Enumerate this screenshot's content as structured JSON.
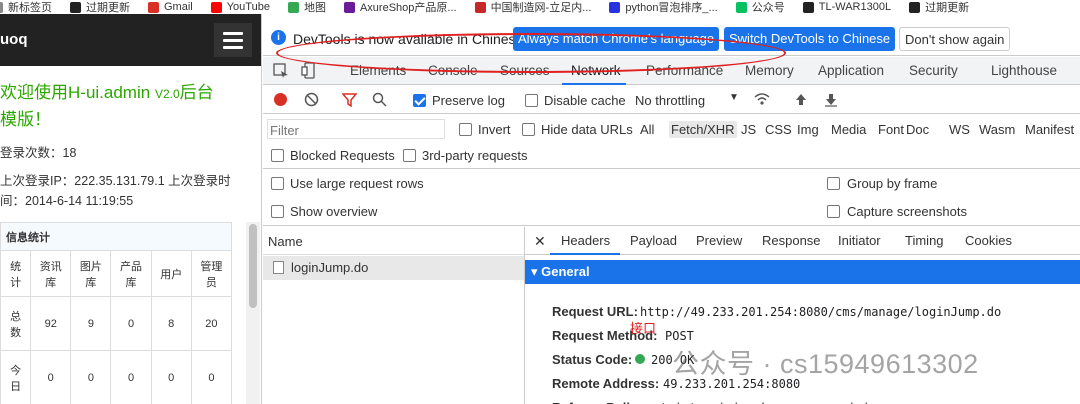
{
  "bookmarks": [
    {
      "label": "新标签页",
      "icon": "tab-icon",
      "color": "#888888"
    },
    {
      "label": "过期更新",
      "icon": "github-icon",
      "color": "#222222"
    },
    {
      "label": "Gmail",
      "icon": "gmail-icon",
      "color": "#d93025"
    },
    {
      "label": "YouTube",
      "icon": "youtube-icon",
      "color": "#ff0000"
    },
    {
      "label": "地图",
      "icon": "maps-icon",
      "color": "#34a853"
    },
    {
      "label": "AxureShop产品原...",
      "icon": "axure-icon",
      "color": "#6a1b9a"
    },
    {
      "label": "中国制造网-立足内...",
      "icon": "mic-icon",
      "color": "#c62828"
    },
    {
      "label": "python冒泡排序_...",
      "icon": "baidu-icon",
      "color": "#2932e1"
    },
    {
      "label": "公众号",
      "icon": "wechat-icon",
      "color": "#07c160"
    },
    {
      "label": "TL-WAR1300L",
      "icon": "tplink-icon",
      "color": "#222222"
    },
    {
      "label": "过期更新",
      "icon": "github-icon",
      "color": "#222222"
    }
  ],
  "admin": {
    "logo": "uoq",
    "welcome_line1": "欢迎使用H-ui.admin",
    "version": "V2.0",
    "welcome_line1_tail": "后台",
    "welcome_line2": "模版！",
    "login_count": "登录次数：18",
    "last_ip": "上次登录IP：222.35.131.79.1 上次登录时",
    "last_time": "间：2014-6-14 11:19:55",
    "stats_caption": "信息统计",
    "stats_headers": [
      "统计",
      "资讯库",
      "图片库",
      "产品库",
      "用户",
      "管理员"
    ],
    "stats_rows": [
      {
        "label": "总数",
        "values": [
          "92",
          "9",
          "0",
          "8",
          "20"
        ]
      },
      {
        "label": "今日",
        "values": [
          "0",
          "0",
          "0",
          "0",
          "0"
        ]
      }
    ]
  },
  "devtools": {
    "info_text": "DevTools is now available in Chinese!",
    "btn_match": "Always match Chrome's language",
    "btn_switch": "Switch DevTools to Chinese",
    "btn_dont": "Don't show again",
    "tabs": [
      "Elements",
      "Console",
      "Sources",
      "Network",
      "Performance",
      "Memory",
      "Application",
      "Security",
      "Lighthouse"
    ],
    "active_tab": "Network",
    "preserve_log": "Preserve log",
    "disable_cache": "Disable cache",
    "throttling": "No throttling",
    "filter_placeholder": "Filter",
    "invert": "Invert",
    "hide_data_urls": "Hide data URLs",
    "type_filters": [
      "All",
      "Fetch/XHR",
      "JS",
      "CSS",
      "Img",
      "Media",
      "Font",
      "Doc",
      "WS",
      "Wasm",
      "Manifest"
    ],
    "blocked_requests": "Blocked Requests",
    "third_party": "3rd-party requests",
    "large_rows": "Use large request rows",
    "show_overview": "Show overview",
    "group_by_frame": "Group by frame",
    "capture_screenshots": "Capture screenshots",
    "name_header": "Name",
    "request_name": "loginJump.do",
    "detail_tabs": [
      "Headers",
      "Payload",
      "Preview",
      "Response",
      "Initiator",
      "Timing",
      "Cookies"
    ],
    "general": "▾ General",
    "headers": [
      {
        "key": "Request URL:",
        "value": "http://49.233.201.254:8080/cms/manage/loginJump.do"
      },
      {
        "key": "Request Method:",
        "value": "POST"
      },
      {
        "key": "Status Code:",
        "value": "200 OK"
      },
      {
        "key": "Remote Address:",
        "value": "49.233.201.254:8080"
      },
      {
        "key": "Referrer Policy:",
        "value": "strict-origin-when-cross-origin"
      }
    ],
    "annotation": "接口",
    "watermark": "公众号 · cs15949613302"
  }
}
